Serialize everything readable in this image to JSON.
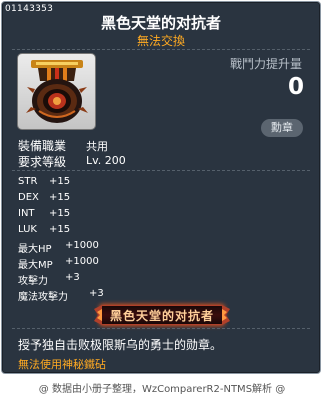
{
  "item": {
    "id": "01143353",
    "name": "黑色天堂的对抗者",
    "trade_status": "無法交換",
    "power_label": "戰鬥力提升量",
    "power_value": "0",
    "badge_label": "勳章"
  },
  "requirements": {
    "job_label": "裝備職業",
    "job_value": "共用",
    "level_label": "要求等級",
    "level_value": "Lv. 200"
  },
  "stats": [
    {
      "name": "STR",
      "value": "+15"
    },
    {
      "name": "DEX",
      "value": "+15"
    },
    {
      "name": "INT",
      "value": "+15"
    },
    {
      "name": "LUK",
      "value": "+15"
    },
    {
      "name": "最大HP",
      "value": "+1000"
    },
    {
      "name": "最大MP",
      "value": "+1000"
    },
    {
      "name": "攻擊力",
      "value": "+3"
    },
    {
      "name": "魔法攻擊力",
      "value": "+3"
    }
  ],
  "set_banner": "黑色天堂的对抗者",
  "description": "授予独自击败极限斯乌的勇士的勋章。",
  "usage_note": "無法使用神秘鐵砧",
  "footer": "@ 数据由小册子整理，WzComparerR2-NTMS解析 @",
  "colors": {
    "panel_bg": "#2a3440",
    "accent_orange": "#ffaa22",
    "banner_border": "#b0402a"
  }
}
